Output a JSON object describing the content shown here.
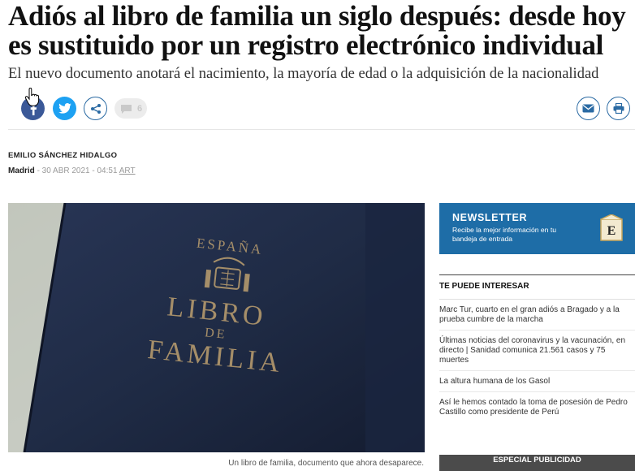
{
  "article": {
    "headline": "Adiós al libro de familia un siglo después: desde hoy es sustituido por un registro electrónico individual",
    "subheadline": "El nuevo documento anotará el nacimiento, la mayoría de edad o la adquisición de la nacionalidad",
    "author": "EMILIO SÁNCHEZ HIDALGO",
    "city": "Madrid",
    "date": "30 ABR 2021 - 04:51",
    "timezone": "ART",
    "image_caption": "Un libro de familia, documento que ahora desaparece.",
    "image_text": {
      "country": "ESPAÑA",
      "title_line1": "LIBRO",
      "title_line2": "DE",
      "title_line3": "FAMILIA"
    }
  },
  "share_bar": {
    "comment_count": "6",
    "icons": [
      "facebook-icon",
      "twitter-icon",
      "share-icon",
      "comment-icon",
      "email-icon",
      "print-icon"
    ]
  },
  "sidebar": {
    "newsletter": {
      "title": "NEWSLETTER",
      "text": "Recibe la mejor información en tu bandeja de entrada"
    },
    "interest": {
      "title": "TE PUEDE INTERESAR",
      "items": [
        "Marc Tur, cuarto en el gran adiós a Bragado y a la prueba cumbre de la marcha",
        "Últimas noticias del coronavirus y la vacunación, en directo | Sanidad comunica 21.561 casos y 75 muertes",
        "La altura humana de los Gasol",
        "Así le hemos contado la toma de posesión de Pedro Castillo como presidente de Perú"
      ]
    },
    "special": "ESPECIAL PUBLICIDAD"
  },
  "colors": {
    "facebook": "#3b5998",
    "twitter": "#1da1f2",
    "accent_blue": "#1e6da7",
    "book_cover": "#1f2b45"
  }
}
